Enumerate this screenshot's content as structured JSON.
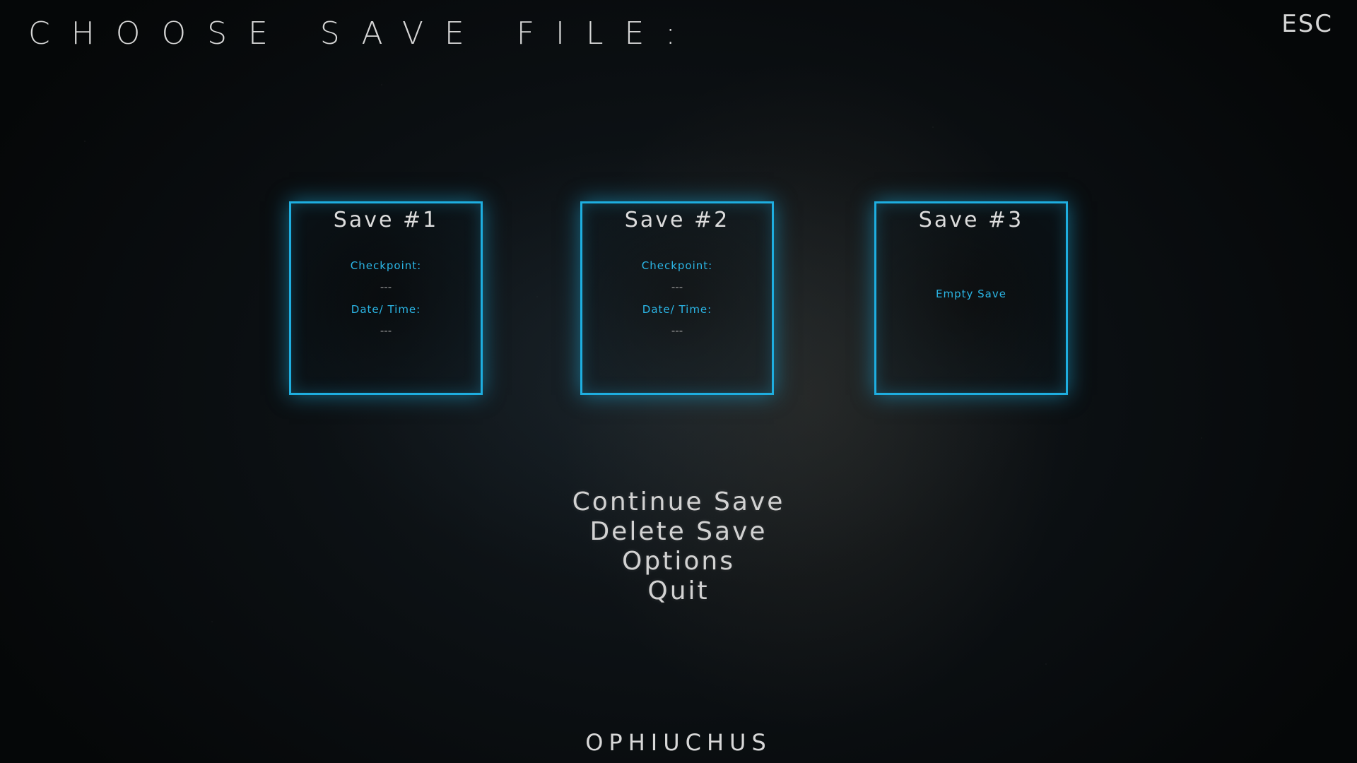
{
  "header": {
    "title": "CHOOSE SAVE FILE:",
    "esc_label": "ESC"
  },
  "saves": [
    {
      "title": "Save #1",
      "checkpoint_label": "Checkpoint:",
      "checkpoint_value": "---",
      "datetime_label": "Date/ Time:",
      "datetime_value": "---"
    },
    {
      "title": "Save #2",
      "checkpoint_label": "Checkpoint:",
      "checkpoint_value": "---",
      "datetime_label": "Date/ Time:",
      "datetime_value": "---"
    },
    {
      "title": "Save #3",
      "empty_label": "Empty Save"
    }
  ],
  "menu": {
    "continue": "Continue Save",
    "delete": "Delete Save",
    "options": "Options",
    "quit": "Quit"
  },
  "footer": {
    "game_title": "OPHIUCHUS"
  },
  "colors": {
    "accent": "#1eaee0",
    "text": "#d6d6d6"
  }
}
